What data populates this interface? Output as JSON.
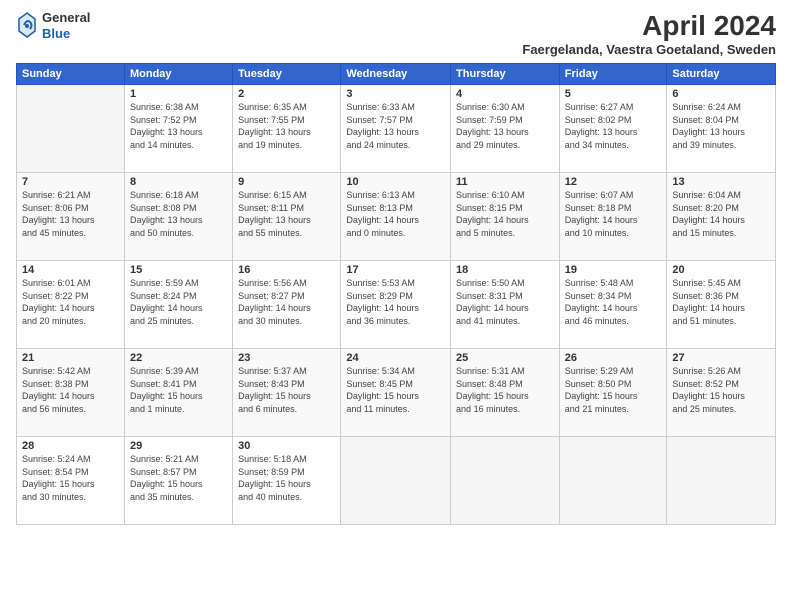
{
  "header": {
    "logo_line1": "General",
    "logo_line2": "Blue",
    "month": "April 2024",
    "location": "Faergelanda, Vaestra Goetaland, Sweden"
  },
  "weekdays": [
    "Sunday",
    "Monday",
    "Tuesday",
    "Wednesday",
    "Thursday",
    "Friday",
    "Saturday"
  ],
  "weeks": [
    [
      {
        "day": "",
        "info": ""
      },
      {
        "day": "1",
        "info": "Sunrise: 6:38 AM\nSunset: 7:52 PM\nDaylight: 13 hours\nand 14 minutes."
      },
      {
        "day": "2",
        "info": "Sunrise: 6:35 AM\nSunset: 7:55 PM\nDaylight: 13 hours\nand 19 minutes."
      },
      {
        "day": "3",
        "info": "Sunrise: 6:33 AM\nSunset: 7:57 PM\nDaylight: 13 hours\nand 24 minutes."
      },
      {
        "day": "4",
        "info": "Sunrise: 6:30 AM\nSunset: 7:59 PM\nDaylight: 13 hours\nand 29 minutes."
      },
      {
        "day": "5",
        "info": "Sunrise: 6:27 AM\nSunset: 8:02 PM\nDaylight: 13 hours\nand 34 minutes."
      },
      {
        "day": "6",
        "info": "Sunrise: 6:24 AM\nSunset: 8:04 PM\nDaylight: 13 hours\nand 39 minutes."
      }
    ],
    [
      {
        "day": "7",
        "info": "Sunrise: 6:21 AM\nSunset: 8:06 PM\nDaylight: 13 hours\nand 45 minutes."
      },
      {
        "day": "8",
        "info": "Sunrise: 6:18 AM\nSunset: 8:08 PM\nDaylight: 13 hours\nand 50 minutes."
      },
      {
        "day": "9",
        "info": "Sunrise: 6:15 AM\nSunset: 8:11 PM\nDaylight: 13 hours\nand 55 minutes."
      },
      {
        "day": "10",
        "info": "Sunrise: 6:13 AM\nSunset: 8:13 PM\nDaylight: 14 hours\nand 0 minutes."
      },
      {
        "day": "11",
        "info": "Sunrise: 6:10 AM\nSunset: 8:15 PM\nDaylight: 14 hours\nand 5 minutes."
      },
      {
        "day": "12",
        "info": "Sunrise: 6:07 AM\nSunset: 8:18 PM\nDaylight: 14 hours\nand 10 minutes."
      },
      {
        "day": "13",
        "info": "Sunrise: 6:04 AM\nSunset: 8:20 PM\nDaylight: 14 hours\nand 15 minutes."
      }
    ],
    [
      {
        "day": "14",
        "info": "Sunrise: 6:01 AM\nSunset: 8:22 PM\nDaylight: 14 hours\nand 20 minutes."
      },
      {
        "day": "15",
        "info": "Sunrise: 5:59 AM\nSunset: 8:24 PM\nDaylight: 14 hours\nand 25 minutes."
      },
      {
        "day": "16",
        "info": "Sunrise: 5:56 AM\nSunset: 8:27 PM\nDaylight: 14 hours\nand 30 minutes."
      },
      {
        "day": "17",
        "info": "Sunrise: 5:53 AM\nSunset: 8:29 PM\nDaylight: 14 hours\nand 36 minutes."
      },
      {
        "day": "18",
        "info": "Sunrise: 5:50 AM\nSunset: 8:31 PM\nDaylight: 14 hours\nand 41 minutes."
      },
      {
        "day": "19",
        "info": "Sunrise: 5:48 AM\nSunset: 8:34 PM\nDaylight: 14 hours\nand 46 minutes."
      },
      {
        "day": "20",
        "info": "Sunrise: 5:45 AM\nSunset: 8:36 PM\nDaylight: 14 hours\nand 51 minutes."
      }
    ],
    [
      {
        "day": "21",
        "info": "Sunrise: 5:42 AM\nSunset: 8:38 PM\nDaylight: 14 hours\nand 56 minutes."
      },
      {
        "day": "22",
        "info": "Sunrise: 5:39 AM\nSunset: 8:41 PM\nDaylight: 15 hours\nand 1 minute."
      },
      {
        "day": "23",
        "info": "Sunrise: 5:37 AM\nSunset: 8:43 PM\nDaylight: 15 hours\nand 6 minutes."
      },
      {
        "day": "24",
        "info": "Sunrise: 5:34 AM\nSunset: 8:45 PM\nDaylight: 15 hours\nand 11 minutes."
      },
      {
        "day": "25",
        "info": "Sunrise: 5:31 AM\nSunset: 8:48 PM\nDaylight: 15 hours\nand 16 minutes."
      },
      {
        "day": "26",
        "info": "Sunrise: 5:29 AM\nSunset: 8:50 PM\nDaylight: 15 hours\nand 21 minutes."
      },
      {
        "day": "27",
        "info": "Sunrise: 5:26 AM\nSunset: 8:52 PM\nDaylight: 15 hours\nand 25 minutes."
      }
    ],
    [
      {
        "day": "28",
        "info": "Sunrise: 5:24 AM\nSunset: 8:54 PM\nDaylight: 15 hours\nand 30 minutes."
      },
      {
        "day": "29",
        "info": "Sunrise: 5:21 AM\nSunset: 8:57 PM\nDaylight: 15 hours\nand 35 minutes."
      },
      {
        "day": "30",
        "info": "Sunrise: 5:18 AM\nSunset: 8:59 PM\nDaylight: 15 hours\nand 40 minutes."
      },
      {
        "day": "",
        "info": ""
      },
      {
        "day": "",
        "info": ""
      },
      {
        "day": "",
        "info": ""
      },
      {
        "day": "",
        "info": ""
      }
    ]
  ]
}
